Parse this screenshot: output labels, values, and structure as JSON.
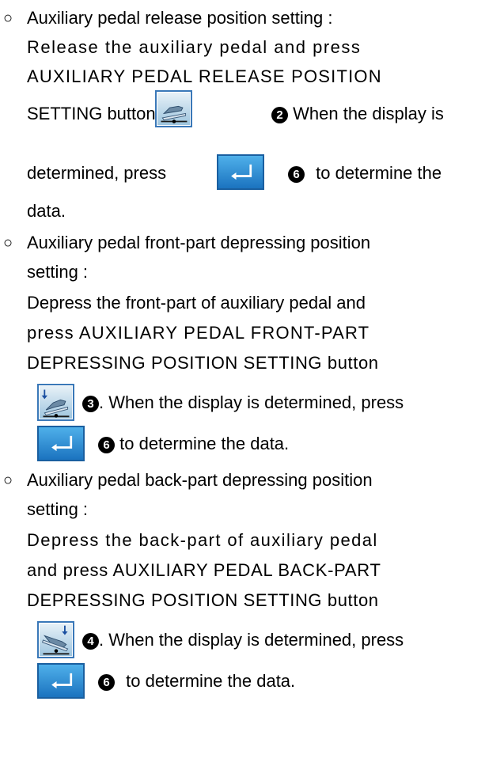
{
  "section1": {
    "bullet": "○",
    "heading": "Auxiliary pedal release position setting :",
    "line2": "Release the auxiliary pedal and press",
    "line3": "AUXILIARY PEDAL RELEASE POSITION",
    "line4a": "SETTING button",
    "marker_a": "2",
    "line4b": "When the display is",
    "line5a": "determined, press",
    "marker_b": "6",
    "line5b": "to determine the",
    "line6": "data."
  },
  "section2": {
    "bullet": "○",
    "heading": "Auxiliary pedal front-part depressing position",
    "heading2": "setting :",
    "line3": "Depress the front-part of auxiliary pedal and",
    "line4": "press AUXILIARY PEDAL FRONT-PART",
    "line5": "DEPRESSING POSITION SETTING button",
    "marker_a": "3",
    "line6": ". When the display is determined, press",
    "marker_b": "6",
    "line7": "to determine the data."
  },
  "section3": {
    "bullet": "○",
    "heading": "Auxiliary pedal back-part depressing position",
    "heading2": "setting :",
    "line3": "Depress the back-part of auxiliary pedal",
    "line4": "and press AUXILIARY PEDAL BACK-PART",
    "line5": "DEPRESSING POSITION SETTING button",
    "marker_a": "4",
    "line6": ". When the display is determined, press",
    "marker_b": "6",
    "line7": "to determine the data."
  },
  "icons": {
    "release": "pedal-release-position-icon",
    "front": "pedal-front-depress-icon",
    "back": "pedal-back-depress-icon",
    "enter": "enter-icon"
  },
  "colors": {
    "enter_button": "#2a8fd8",
    "pedal_button": "#b8d4ea",
    "text": "#000000"
  }
}
